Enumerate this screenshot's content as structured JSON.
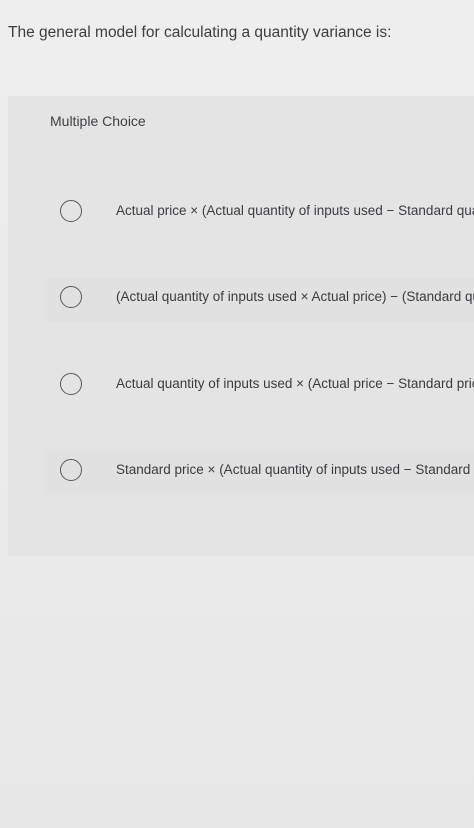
{
  "question": {
    "text": "The general model for calculating a quantity variance is:"
  },
  "multiple_choice": {
    "label": "Multiple Choice",
    "options": [
      {
        "text": "Actual price × (Actual quantity of inputs used − Standard qua",
        "icon": "radio-unselected-icon"
      },
      {
        "text": "(Actual quantity of inputs used × Actual price) − (Standard qu",
        "icon": "radio-unselected-icon"
      },
      {
        "text": "Actual quantity of inputs used × (Actual price − Standard price",
        "icon": "radio-unselected-icon"
      },
      {
        "text": "Standard price × (Actual quantity of inputs used − Standard q",
        "icon": "radio-unselected-icon"
      }
    ]
  },
  "colors": {
    "background": "#ececec",
    "panel": "#e4e4e4",
    "text": "#3f4145"
  }
}
